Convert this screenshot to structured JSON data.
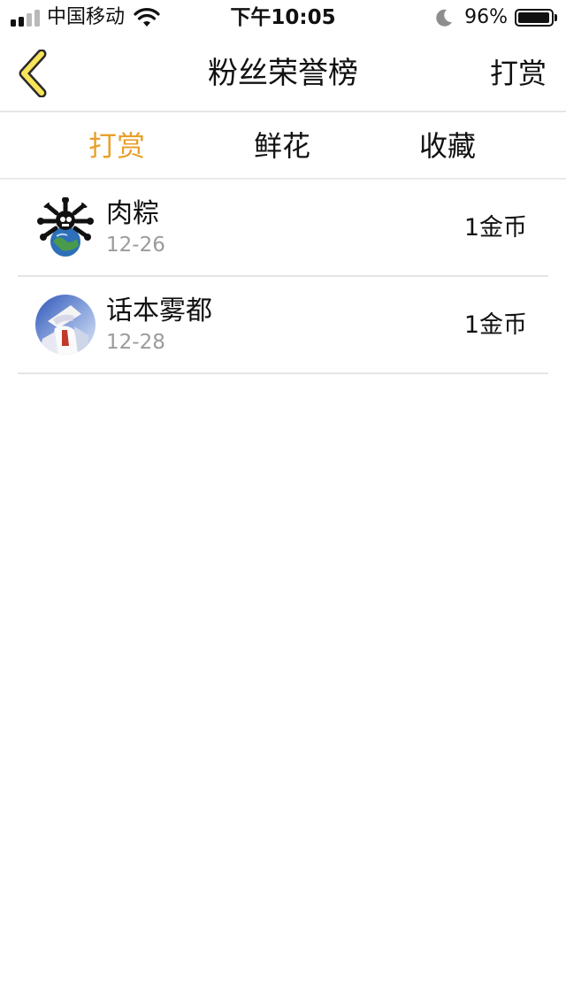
{
  "status_bar": {
    "carrier": "中国移动",
    "time": "下午10:05",
    "battery": "96%",
    "battery_level": 0.96,
    "signal_bars": 2
  },
  "nav": {
    "title": "粉丝荣誉榜",
    "action": "打赏",
    "back_icon": "chevron-left-icon"
  },
  "tabs": [
    {
      "label": "打赏",
      "active": true
    },
    {
      "label": "鲜花",
      "active": false
    },
    {
      "label": "收藏",
      "active": false
    }
  ],
  "list": [
    {
      "name": "肉粽",
      "date": "12-26",
      "amount": "1金币"
    },
    {
      "name": "话本雾都",
      "date": "12-28",
      "amount": "1金币"
    }
  ],
  "colors": {
    "accent": "#e8a02b",
    "back_icon_fill": "#f7e45a",
    "divider": "#e6e6e6",
    "secondary_text": "#9b9b9b"
  }
}
